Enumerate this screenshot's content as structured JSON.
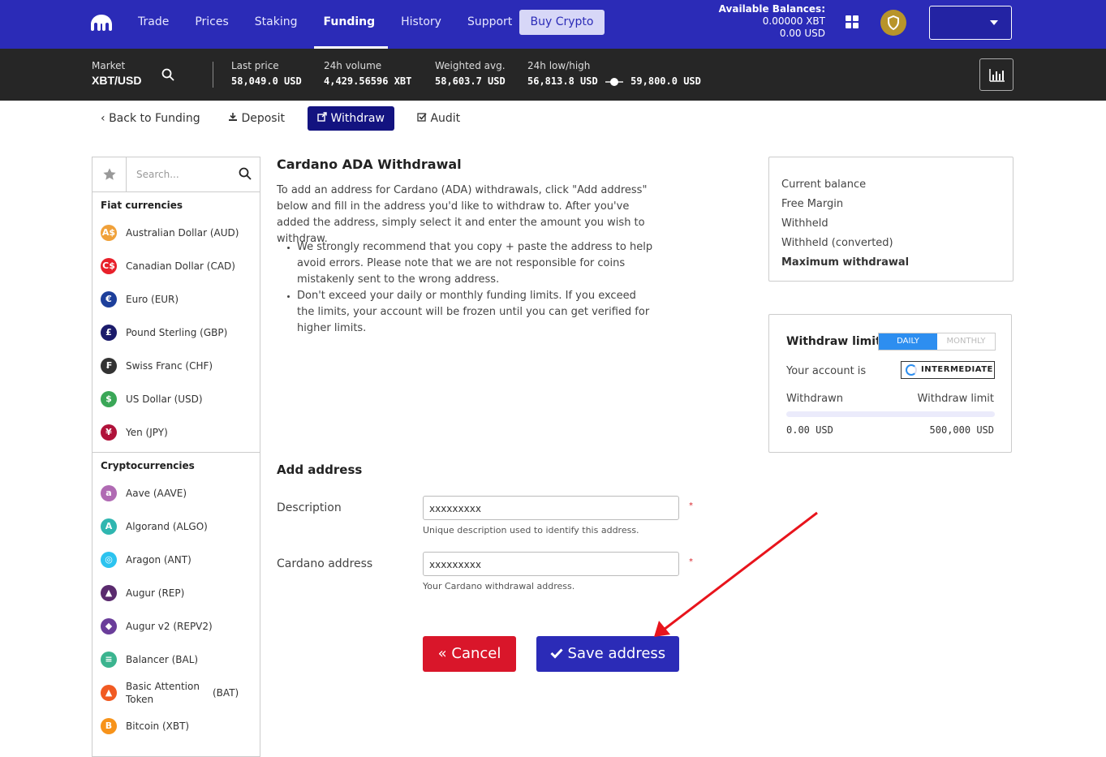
{
  "topnav": {
    "links": [
      "Trade",
      "Prices",
      "Staking",
      "Funding",
      "History",
      "Support"
    ],
    "active": "Funding",
    "buy_label": "Buy Crypto",
    "balances_label": "Available Balances:",
    "balance_xbt": "0.00000 XBT",
    "balance_usd": "0.00 USD"
  },
  "ticker": {
    "market_label": "Market",
    "market_value": "XBT/USD",
    "last_price_label": "Last price",
    "last_price": "58,049.0 USD",
    "volume_label": "24h volume",
    "volume": "4,429.56596 XBT",
    "wavg_label": "Weighted avg.",
    "wavg": "58,603.7 USD",
    "lowhigh_label": "24h low/high",
    "low": "56,813.8 USD",
    "high": "59,800.0 USD"
  },
  "subnav": {
    "back": "Back to Funding",
    "deposit": "Deposit",
    "withdraw": "Withdraw",
    "audit": "Audit"
  },
  "sidebar": {
    "search_placeholder": "Search...",
    "fiat_heading": "Fiat currencies",
    "fiat": [
      {
        "name": "Australian Dollar (AUD)",
        "symbol": "A$",
        "color": "#f0a13a"
      },
      {
        "name": "Canadian Dollar (CAD)",
        "symbol": "C$",
        "color": "#e8202a"
      },
      {
        "name": "Euro (EUR)",
        "symbol": "€",
        "color": "#1d3f9b"
      },
      {
        "name": "Pound Sterling (GBP)",
        "symbol": "£",
        "color": "#1b1b6b"
      },
      {
        "name": "Swiss Franc (CHF)",
        "symbol": "₣",
        "color": "#333333"
      },
      {
        "name": "US Dollar (USD)",
        "symbol": "$",
        "color": "#3aa757"
      },
      {
        "name": "Yen (JPY)",
        "symbol": "¥",
        "color": "#b0123a"
      }
    ],
    "crypto_heading": "Cryptocurrencies",
    "crypto": [
      {
        "name": "Aave (AAVE)",
        "symbol": "a",
        "color": "#b06ab3"
      },
      {
        "name": "Algorand (ALGO)",
        "symbol": "A",
        "color": "#2fb6b0"
      },
      {
        "name": "Aragon (ANT)",
        "symbol": "◎",
        "color": "#2cc3ef"
      },
      {
        "name": "Augur (REP)",
        "symbol": "▲",
        "color": "#5a2a6e"
      },
      {
        "name": "Augur v2 (REPV2)",
        "symbol": "◆",
        "color": "#6a3d9a"
      },
      {
        "name": "Balancer (BAL)",
        "symbol": "≡",
        "color": "#3bb48f"
      },
      {
        "name": "Basic Attention Token",
        "code": "(BAT)",
        "symbol": "▲",
        "color": "#f15a22"
      },
      {
        "name": "Bitcoin (XBT)",
        "symbol": "B",
        "color": "#f7931a"
      }
    ]
  },
  "main": {
    "title": "Cardano ADA Withdrawal",
    "intro": "To add an address for Cardano (ADA) withdrawals, click \"Add address\" below and fill in the address you'd like to withdraw to. After you've added the address, simply select it and enter the amount you wish to withdraw.",
    "bullets": [
      "We strongly recommend that you copy + paste the address to help avoid errors. Please note that we are not responsible for coins mistakenly sent to the wrong address.",
      "Don't exceed your daily or monthly funding limits. If you exceed the limits, your account will be frozen until you can get verified for higher limits."
    ],
    "add_title": "Add address",
    "description_label": "Description",
    "description_value": "xxxxxxxxx",
    "description_help": "Unique description used to identify this address.",
    "address_label": "Cardano address",
    "address_value": "xxxxxxxxx",
    "address_help": "Your Cardano withdrawal address.",
    "required": "*",
    "cancel_label": "« Cancel",
    "save_label": "Save address"
  },
  "balance_panel": {
    "current": "Current balance",
    "free_margin": "Free Margin",
    "withheld": "Withheld",
    "withheld_converted": "Withheld (converted)",
    "max_withdrawal": "Maximum withdrawal"
  },
  "limits_panel": {
    "title": "Withdraw limits",
    "daily": "DAILY",
    "monthly": "MONTHLY",
    "account_is": "Your account is",
    "tier": "INTERMEDIATE",
    "withdrawn_label": "Withdrawn",
    "limit_label": "Withdraw limit",
    "withdrawn_value": "0.00 USD",
    "limit_value": "500,000 USD",
    "progress_fraction": 0.0
  },
  "colors": {
    "brand": "#2b2bb7",
    "ticker_bg": "#262626",
    "cancel": "#d9162a",
    "annotation_arrow": "#e8141c"
  }
}
